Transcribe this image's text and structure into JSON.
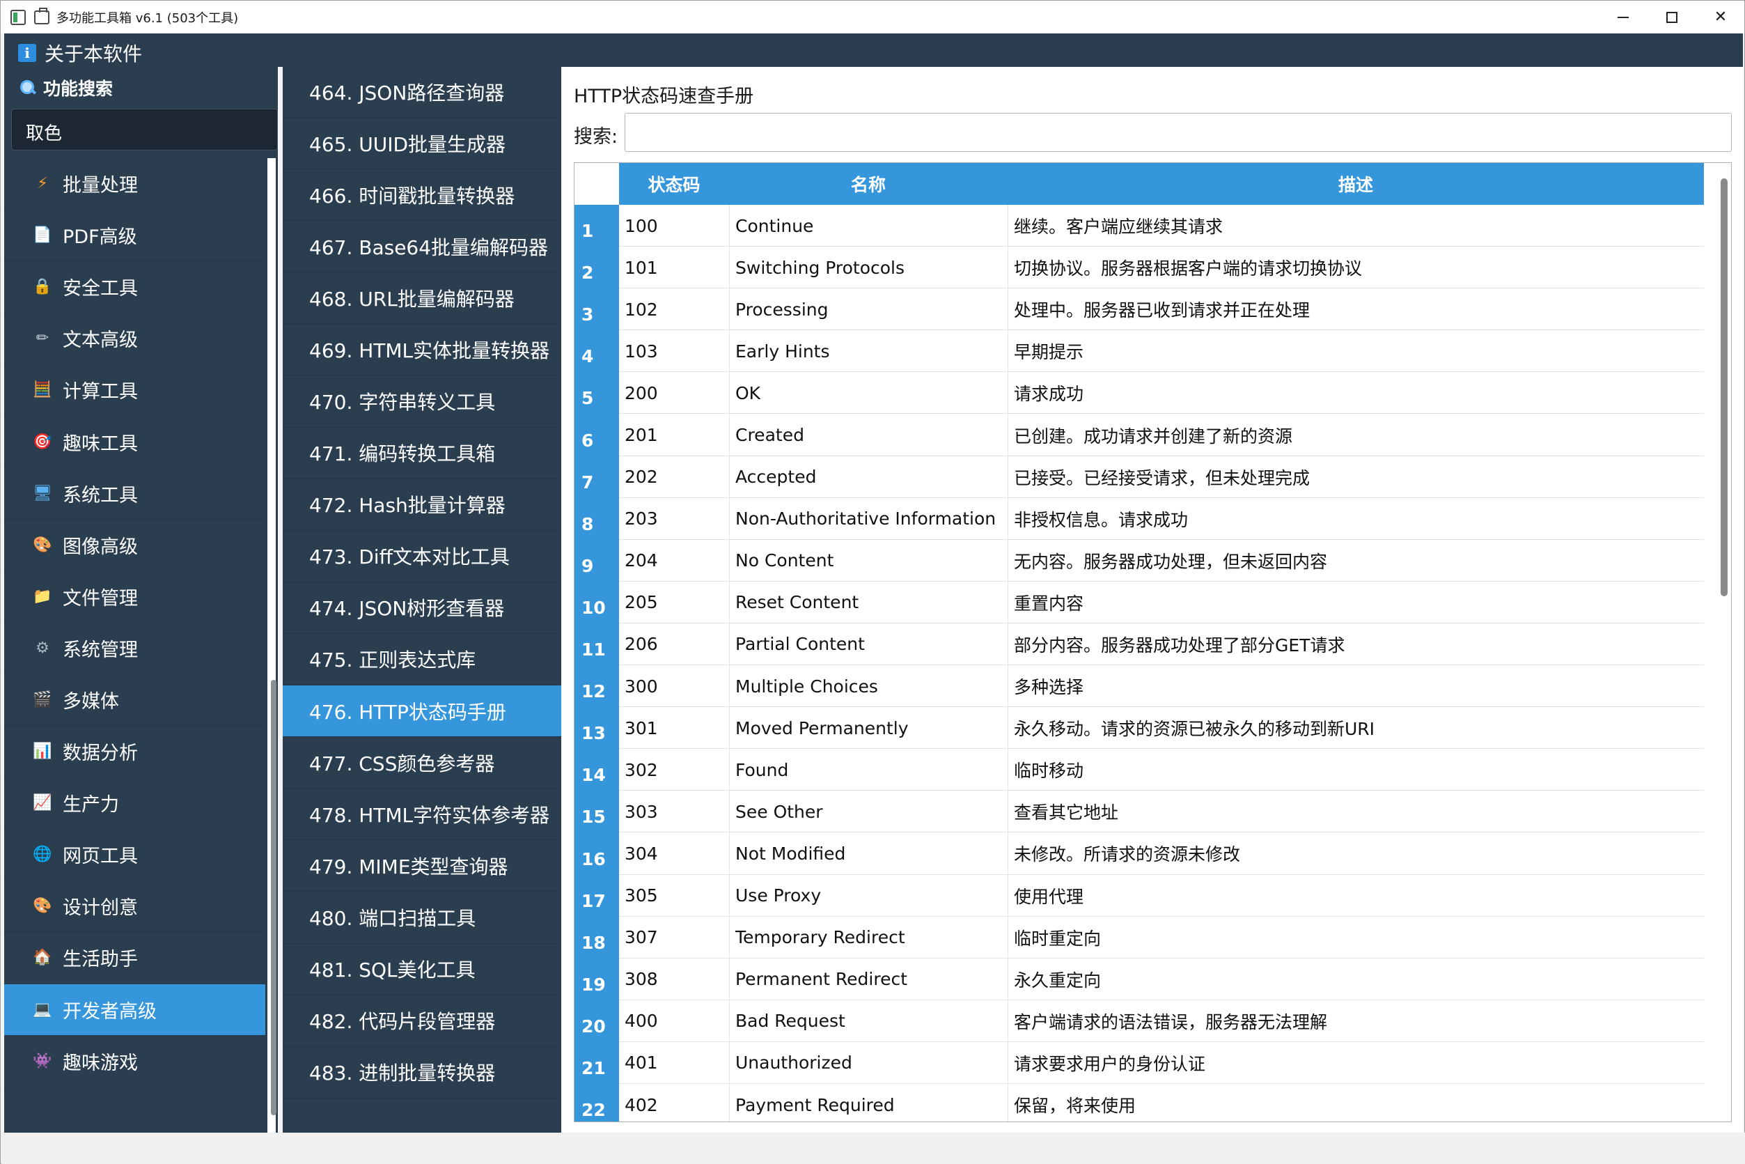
{
  "window": {
    "title": "多功能工具箱 v6.1 (503个工具)"
  },
  "header": {
    "about_label": "关于本软件",
    "about_icon": "info-icon"
  },
  "sidebar": {
    "search_heading": "功能搜索",
    "search_value": "取色",
    "categories": [
      {
        "label": "批量处理",
        "icon": "lightning-icon",
        "glyph": "⚡",
        "color": "#ff9b2f"
      },
      {
        "label": "PDF高级",
        "icon": "document-icon",
        "glyph": "📄",
        "color": "#f2c14e"
      },
      {
        "label": "安全工具",
        "icon": "lock-icon",
        "glyph": "🔒",
        "color": "#f2b233"
      },
      {
        "label": "文本高级",
        "icon": "pencil-icon",
        "glyph": "✏",
        "color": "#c9d4de"
      },
      {
        "label": "计算工具",
        "icon": "abacus-icon",
        "glyph": "🧮",
        "color": "#e56b4a"
      },
      {
        "label": "趣味工具",
        "icon": "target-icon",
        "glyph": "🎯",
        "color": "#e04545"
      },
      {
        "label": "系统工具",
        "icon": "monitor-icon",
        "glyph": "🖥",
        "color": "#5ab0f0"
      },
      {
        "label": "图像高级",
        "icon": "palette-icon",
        "glyph": "🎨",
        "color": "#e9a86f"
      },
      {
        "label": "文件管理",
        "icon": "folder-icon",
        "glyph": "📁",
        "color": "#f5c242"
      },
      {
        "label": "系统管理",
        "icon": "gear-icon",
        "glyph": "⚙",
        "color": "#a9b4bf"
      },
      {
        "label": "多媒体",
        "icon": "clapperboard-icon",
        "glyph": "🎬",
        "color": "#b48be0"
      },
      {
        "label": "数据分析",
        "icon": "bar-chart-icon",
        "glyph": "📊",
        "color": "#7fc4f0"
      },
      {
        "label": "生产力",
        "icon": "line-chart-icon",
        "glyph": "📈",
        "color": "#f07a8a"
      },
      {
        "label": "网页工具",
        "icon": "globe-icon",
        "glyph": "🌐",
        "color": "#8fc7f5"
      },
      {
        "label": "设计创意",
        "icon": "palette-icon",
        "glyph": "🎨",
        "color": "#e9a86f"
      },
      {
        "label": "生活助手",
        "icon": "house-icon",
        "glyph": "🏠",
        "color": "#f0a050"
      },
      {
        "label": "开发者高级",
        "icon": "laptop-icon",
        "glyph": "💻",
        "color": "#9fd0f5",
        "active": true
      },
      {
        "label": "趣味游戏",
        "icon": "gamepad-icon",
        "glyph": "👾",
        "color": "#a98be0"
      }
    ]
  },
  "tools": [
    {
      "label": "464. JSON路径查询器"
    },
    {
      "label": "465. UUID批量生成器"
    },
    {
      "label": "466. 时间戳批量转换器"
    },
    {
      "label": "467. Base64批量编解码器"
    },
    {
      "label": "468. URL批量编解码器"
    },
    {
      "label": "469. HTML实体批量转换器"
    },
    {
      "label": "470. 字符串转义工具"
    },
    {
      "label": "471. 编码转换工具箱"
    },
    {
      "label": "472. Hash批量计算器"
    },
    {
      "label": "473. Diff文本对比工具"
    },
    {
      "label": "474. JSON树形查看器"
    },
    {
      "label": "475. 正则表达式库"
    },
    {
      "label": "476. HTTP状态码手册",
      "active": true
    },
    {
      "label": "477. CSS颜色参考器"
    },
    {
      "label": "478. HTML字符实体参考器"
    },
    {
      "label": "479. MIME类型查询器"
    },
    {
      "label": "480. 端口扫描工具"
    },
    {
      "label": "481. SQL美化工具"
    },
    {
      "label": "482. 代码片段管理器"
    },
    {
      "label": "483. 进制批量转换器"
    }
  ],
  "main": {
    "title": "HTTP状态码速查手册",
    "search_label": "搜索:",
    "search_value": "",
    "columns": {
      "code": "状态码",
      "name": "名称",
      "desc": "描述"
    },
    "rows": [
      {
        "n": "1",
        "code": "100",
        "name": "Continue",
        "desc": "继续。客户端应继续其请求"
      },
      {
        "n": "2",
        "code": "101",
        "name": "Switching Protocols",
        "desc": "切换协议。服务器根据客户端的请求切换协议"
      },
      {
        "n": "3",
        "code": "102",
        "name": "Processing",
        "desc": "处理中。服务器已收到请求并正在处理"
      },
      {
        "n": "4",
        "code": "103",
        "name": "Early Hints",
        "desc": "早期提示"
      },
      {
        "n": "5",
        "code": "200",
        "name": "OK",
        "desc": "请求成功"
      },
      {
        "n": "6",
        "code": "201",
        "name": "Created",
        "desc": "已创建。成功请求并创建了新的资源"
      },
      {
        "n": "7",
        "code": "202",
        "name": "Accepted",
        "desc": "已接受。已经接受请求，但未处理完成"
      },
      {
        "n": "8",
        "code": "203",
        "name": "Non-Authoritative Information",
        "desc": "非授权信息。请求成功"
      },
      {
        "n": "9",
        "code": "204",
        "name": "No Content",
        "desc": "无内容。服务器成功处理，但未返回内容"
      },
      {
        "n": "10",
        "code": "205",
        "name": "Reset Content",
        "desc": "重置内容"
      },
      {
        "n": "11",
        "code": "206",
        "name": "Partial Content",
        "desc": "部分内容。服务器成功处理了部分GET请求"
      },
      {
        "n": "12",
        "code": "300",
        "name": "Multiple Choices",
        "desc": "多种选择"
      },
      {
        "n": "13",
        "code": "301",
        "name": "Moved Permanently",
        "desc": "永久移动。请求的资源已被永久的移动到新URI"
      },
      {
        "n": "14",
        "code": "302",
        "name": "Found",
        "desc": "临时移动"
      },
      {
        "n": "15",
        "code": "303",
        "name": "See Other",
        "desc": "查看其它地址"
      },
      {
        "n": "16",
        "code": "304",
        "name": "Not Modified",
        "desc": "未修改。所请求的资源未修改"
      },
      {
        "n": "17",
        "code": "305",
        "name": "Use Proxy",
        "desc": "使用代理"
      },
      {
        "n": "18",
        "code": "307",
        "name": "Temporary Redirect",
        "desc": "临时重定向"
      },
      {
        "n": "19",
        "code": "308",
        "name": "Permanent Redirect",
        "desc": "永久重定向"
      },
      {
        "n": "20",
        "code": "400",
        "name": "Bad Request",
        "desc": "客户端请求的语法错误，服务器无法理解"
      },
      {
        "n": "21",
        "code": "401",
        "name": "Unauthorized",
        "desc": "请求要求用户的身份认证"
      },
      {
        "n": "22",
        "code": "402",
        "name": "Payment Required",
        "desc": "保留，将来使用"
      }
    ]
  },
  "colors": {
    "sidebar_bg": "#2b3e50",
    "accent": "#3596dc"
  }
}
